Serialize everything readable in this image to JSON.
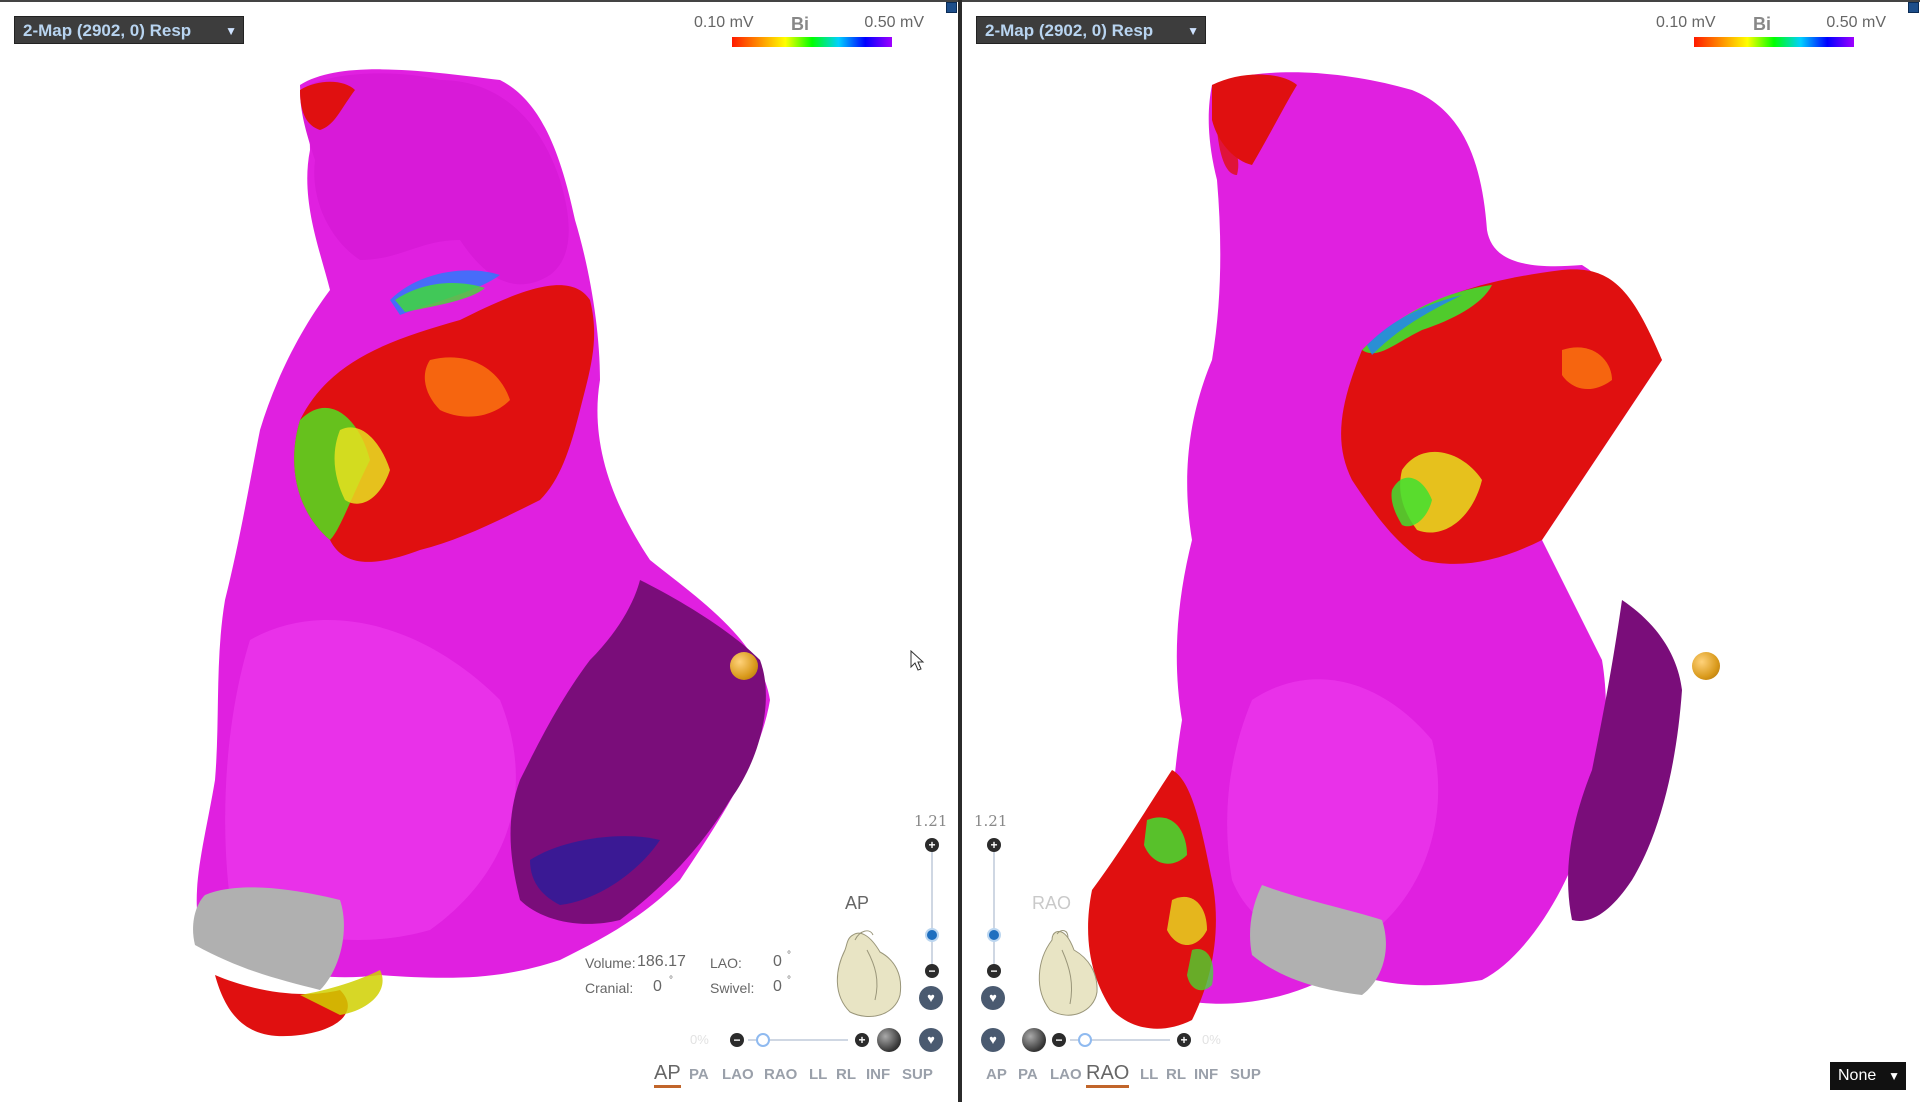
{
  "left_panel": {
    "map_select": "2-Map (2902, 0) Resp",
    "legend": {
      "low": "0.10 mV",
      "mode": "Bi",
      "high": "0.50 mV"
    },
    "volume_label": "Volume:",
    "volume_value": "186.17",
    "lao_label": "LAO:",
    "lao_value": "0",
    "cranial_label": "Cranial:",
    "cranial_value": "0",
    "swivel_label": "Swivel:",
    "swivel_value": "0",
    "degree": "°",
    "zoom_value": "1.21",
    "orientation": "AP",
    "transparency_pct": "0%",
    "views": [
      "AP",
      "PA",
      "LAO",
      "RAO",
      "LL",
      "RL",
      "INF",
      "SUP"
    ],
    "active_view": "AP"
  },
  "right_panel": {
    "map_select": "2-Map (2902, 0) Resp",
    "legend": {
      "low": "0.10 mV",
      "mode": "Bi",
      "high": "0.50 mV"
    },
    "zoom_value": "1.21",
    "orientation": "RAO",
    "transparency_pct": "0%",
    "views": [
      "AP",
      "PA",
      "LAO",
      "RAO",
      "LL",
      "RL",
      "INF",
      "SUP"
    ],
    "active_view": "RAO"
  },
  "bottom_select": "None",
  "colors": {
    "tissue_magenta": "#e020e0",
    "scar_red": "#e01010",
    "dark_purple": "#7a0d7a",
    "valve_gray": "#b0b0b0",
    "marker_gold": "#e0a020"
  },
  "icons": [
    "chevron-down-icon",
    "heart-orientation-icon",
    "heart-reset-icon",
    "mouse-cursor-icon",
    "plus-icon",
    "minus-icon",
    "sphere-icon"
  ]
}
